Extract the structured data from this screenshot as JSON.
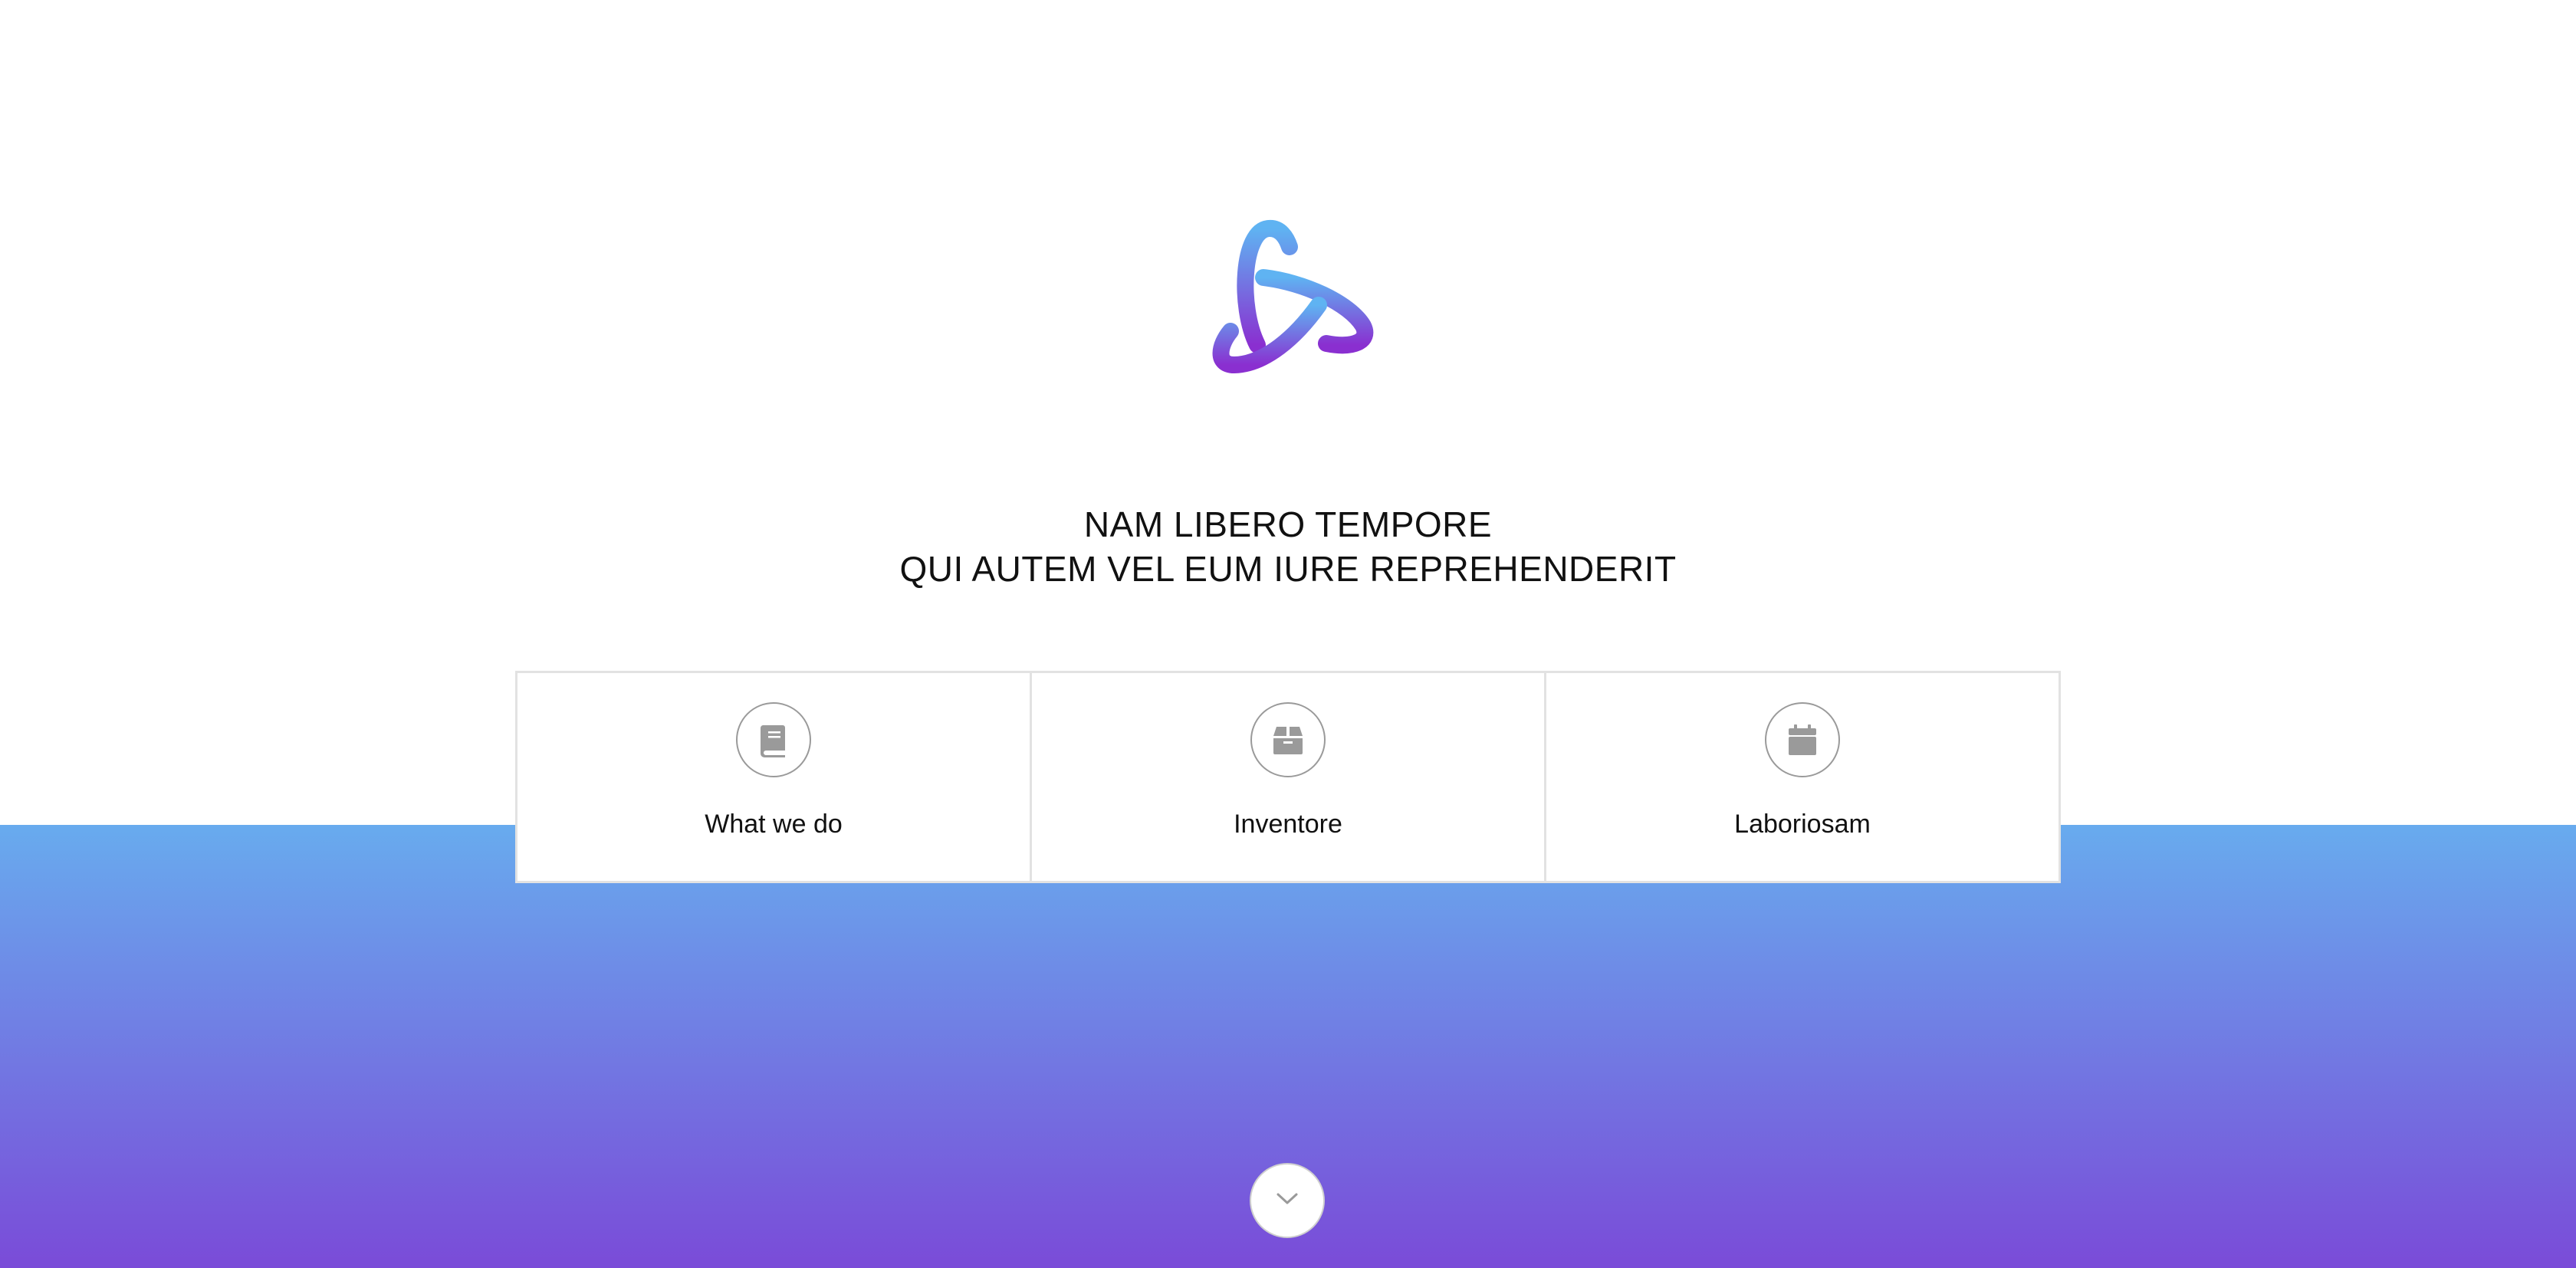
{
  "hero": {
    "logo_icon": "triquetra-logo-icon",
    "headline_line1": "NAM LIBERO TEMPORE",
    "headline_line2": "QUI AUTEM VEL EUM IURE REPREHENDERIT"
  },
  "cards": [
    {
      "icon": "book-icon",
      "label": "What we do"
    },
    {
      "icon": "box-icon",
      "label": "Inventore"
    },
    {
      "icon": "calendar-icon",
      "label": "Laboriosam"
    }
  ],
  "scroll": {
    "icon": "chevron-down-icon"
  },
  "colors": {
    "gradient_top": "#68abee",
    "gradient_bottom": "#7a4bd8",
    "icon_gray": "#9a9a9a",
    "text": "#111111"
  }
}
